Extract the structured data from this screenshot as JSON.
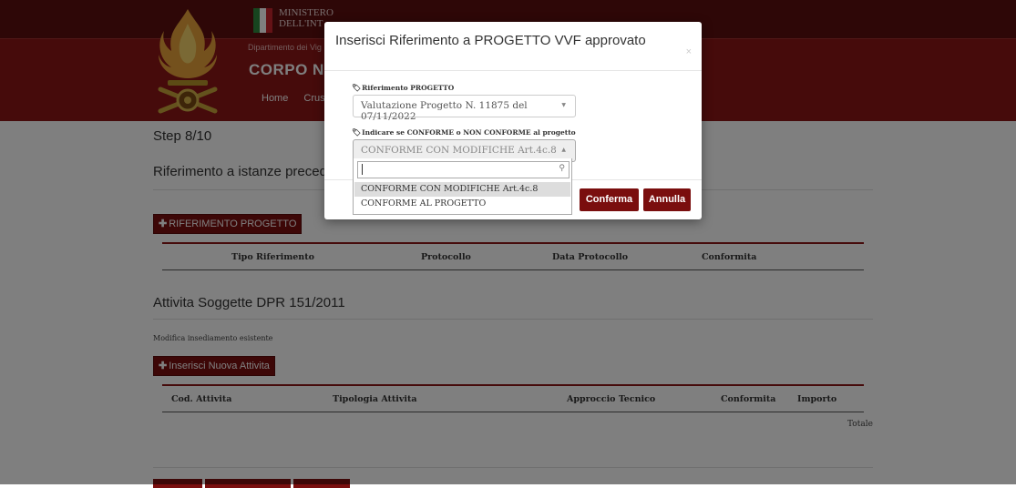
{
  "header": {
    "ministero": "MINISTERO\nDELL'INT",
    "dipartimento": "Dipartimento dei Vig",
    "corpo": "CORPO NA",
    "nav": [
      "Home",
      "Crus"
    ],
    "colors": {
      "header_bg": "#8c1616",
      "header_top": "#5d0f0f"
    }
  },
  "page": {
    "step": "Step 8/10",
    "section1_title": "Riferimento a istanze precede",
    "add_project_button": "RIFERIMENTO PROGETTO",
    "table1_headers": [
      "Tipo Riferimento",
      "Protocollo",
      "Data Protocollo",
      "Conformita"
    ],
    "section2_title": "Attivita Soggette DPR 151/2011",
    "subtext": "Modifica insediamento esistente",
    "add_activity_button": "Inserisci Nuova Attivita",
    "table2_headers": [
      "Cod. Attivita",
      "Tipologia Attivita",
      "Approccio Tecnico",
      "Conformita",
      "Importo"
    ],
    "totale": "Totale"
  },
  "modal": {
    "title": "Inserisci Riferimento a PROGETTO VVF approvato",
    "close": "×",
    "field1_label": "Riferimento PROGETTO",
    "field1_value": "Valutazione Progetto N. 11875 del 07/11/2022",
    "field2_label": "Indicare se CONFORME o NON CONFORME al progetto",
    "field2_value": "CONFORME CON MODIFICHE Art.4c.8",
    "search_value": "",
    "options": [
      "CONFORME CON MODIFICHE Art.4c.8",
      "CONFORME AL PROGETTO"
    ],
    "confirm_label": "Conferma",
    "cancel_label": "Annulla"
  }
}
